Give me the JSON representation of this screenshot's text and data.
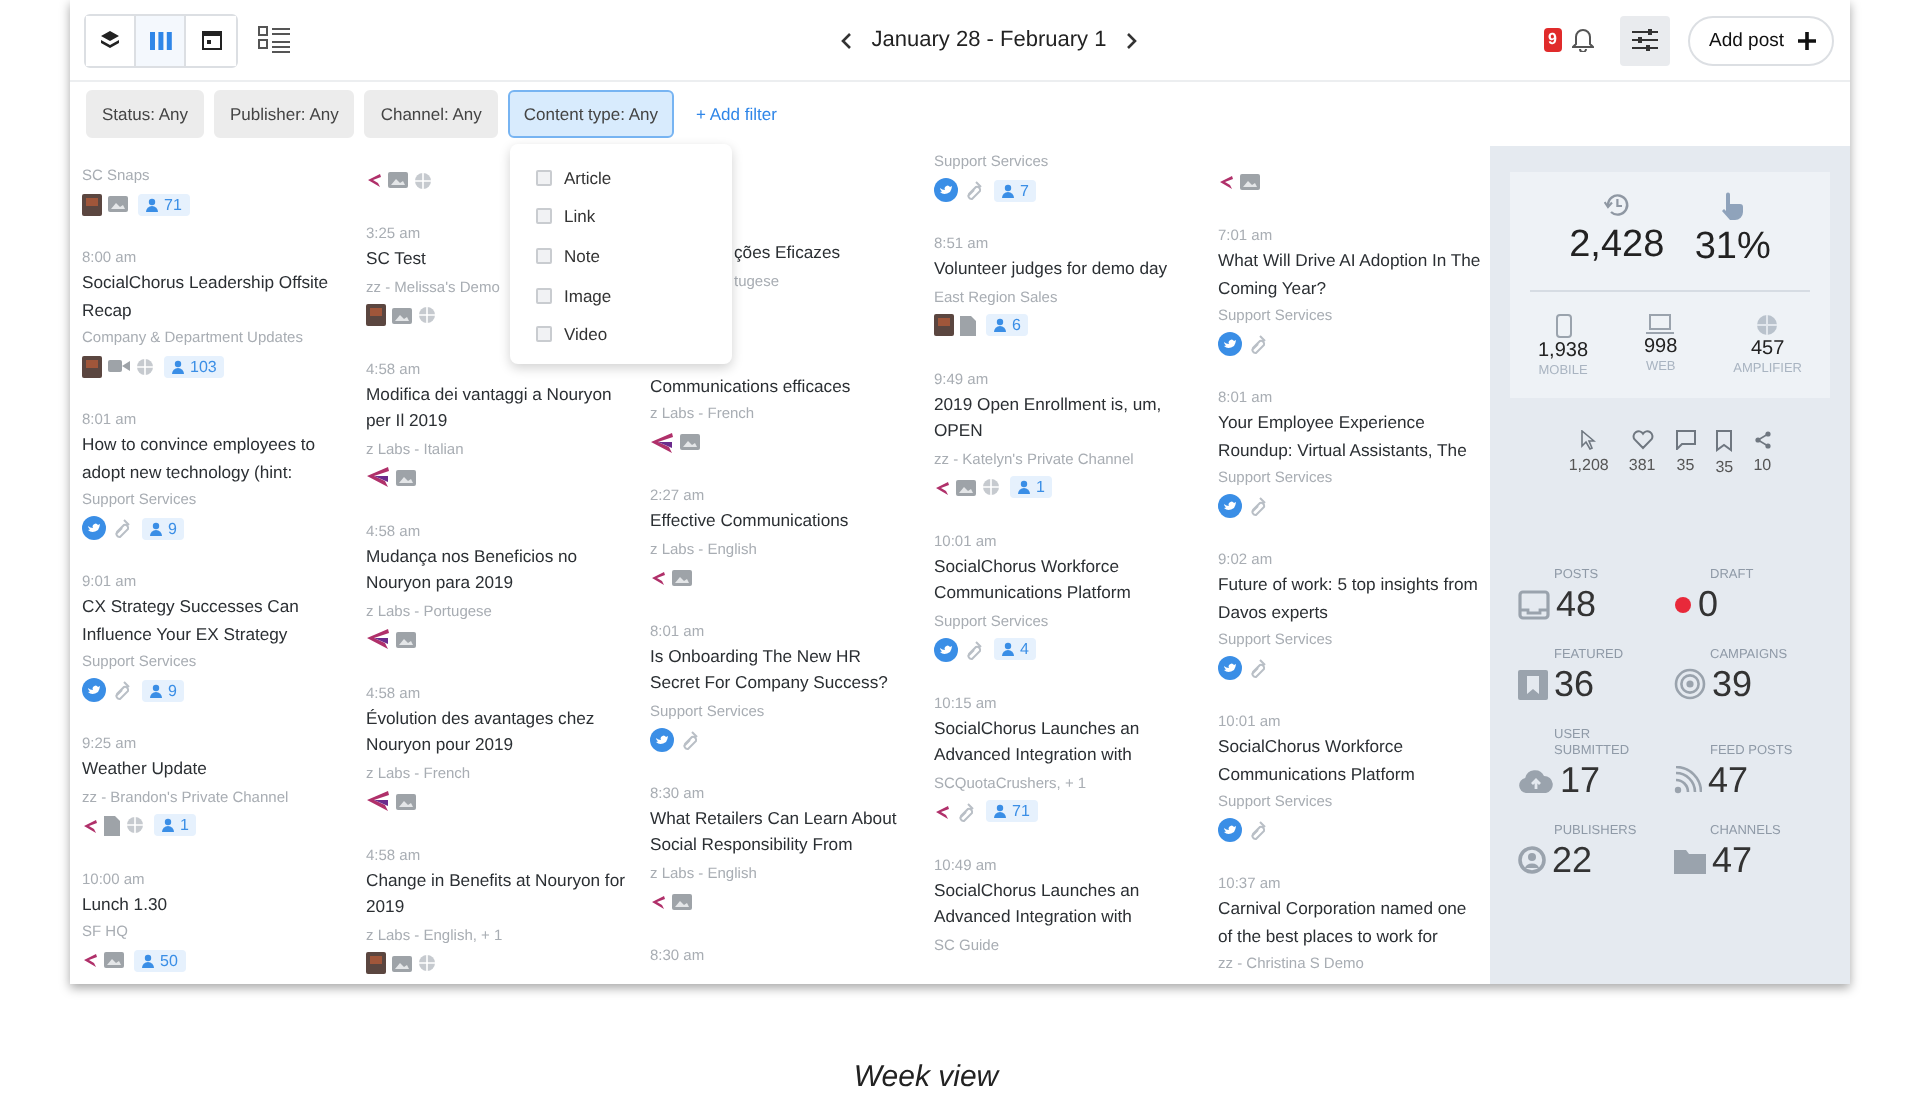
{
  "toolbar": {
    "view_buttons": [
      {
        "kind": "stack",
        "selected": false
      },
      {
        "kind": "columns",
        "selected": true
      },
      {
        "kind": "calendar",
        "selected": false
      }
    ],
    "date_range": "January 28 - February 1",
    "notifications": "9",
    "add_post": "Add post"
  },
  "filters": [
    {
      "label": "Status: Any",
      "selected": false
    },
    {
      "label": "Publisher: Any",
      "selected": false
    },
    {
      "label": "Channel: Any",
      "selected": false
    },
    {
      "label": "Content type: Any",
      "selected": true
    }
  ],
  "add_filter": "+ Add filter",
  "dropdown": {
    "options": [
      {
        "label": "Article",
        "checked": false
      },
      {
        "label": "Link",
        "checked": false
      },
      {
        "label": "Note",
        "checked": false
      },
      {
        "label": "Image",
        "checked": false
      },
      {
        "label": "Video",
        "checked": false
      }
    ]
  },
  "columns": [
    {
      "posts": [
        {
          "source": "SC Snaps",
          "icons": [
            {
              "kind": "thumb"
            },
            {
              "kind": "image"
            }
          ],
          "audience": "71"
        },
        {
          "time": "8:00 am",
          "title": "SocialChorus Leadership Offsite Recap",
          "source": "Company & Department Updates",
          "icons": [
            {
              "kind": "thumb"
            },
            {
              "kind": "video"
            },
            {
              "kind": "globe"
            }
          ],
          "audience": "103"
        },
        {
          "time": "8:01 am",
          "title": "How to convince employees to adopt new technology (hint:",
          "source": "Support Services",
          "icons": [
            {
              "kind": "bird"
            },
            {
              "kind": "link"
            }
          ],
          "audience": "9"
        },
        {
          "time": "9:01 am",
          "title": "CX Strategy Successes Can Influence Your EX Strategy",
          "source": "Support Services",
          "icons": [
            {
              "kind": "bird"
            },
            {
              "kind": "link"
            }
          ],
          "audience": "9"
        },
        {
          "time": "9:25 am",
          "title": "Weather Update",
          "source": "zz - Brandon's Private Channel",
          "icons": [
            {
              "kind": "swoosh"
            },
            {
              "kind": "doc"
            },
            {
              "kind": "globe"
            }
          ],
          "audience": "1"
        },
        {
          "time": "10:00 am",
          "title": "Lunch 1.30",
          "source": "SF HQ",
          "icons": [
            {
              "kind": "swoosh"
            },
            {
              "kind": "image"
            }
          ],
          "audience": "50"
        }
      ]
    },
    {
      "posts": [
        {
          "icons": [
            {
              "kind": "swoosh"
            },
            {
              "kind": "image"
            },
            {
              "kind": "globe"
            }
          ]
        },
        {
          "time": "3:25 am",
          "title": "SC Test",
          "source": "zz - Melissa's Demo",
          "icons": [
            {
              "kind": "thumb"
            },
            {
              "kind": "image"
            },
            {
              "kind": "globe"
            }
          ]
        },
        {
          "time": "4:58 am",
          "title": "Modifica dei vantaggi a Nouryon per Il 2019",
          "source": "z Labs - Italian",
          "icons": [
            {
              "kind": "swoosh-large"
            },
            {
              "kind": "image"
            }
          ]
        },
        {
          "time": "4:58 am",
          "title": "Mudança nos Beneficios no Nouryon para 2019",
          "source": "z Labs - Portugese",
          "icons": [
            {
              "kind": "swoosh-large"
            },
            {
              "kind": "image"
            }
          ]
        },
        {
          "time": "4:58 am",
          "title": "Évolution des avantages chez Nouryon pour 2019",
          "source": "z Labs - French",
          "icons": [
            {
              "kind": "swoosh-large"
            },
            {
              "kind": "image"
            }
          ]
        },
        {
          "time": "4:58 am",
          "title": "Change in Benefits at Nouryon for 2019",
          "source": "z Labs - English, + 1",
          "icons": [
            {
              "kind": "thumb"
            },
            {
              "kind": "image"
            },
            {
              "kind": "globe"
            }
          ]
        }
      ]
    },
    {
      "posts": [
        {
          "kind": "covered",
          "title": "ções Eficazes",
          "source": "tugese"
        },
        {
          "title": "Communications efficaces",
          "source": "z Labs - French",
          "icons": [
            {
              "kind": "swoosh-large"
            },
            {
              "kind": "image"
            }
          ]
        },
        {
          "time": "2:27 am",
          "title": "Effective Communications",
          "source": "z Labs - English",
          "icons": [
            {
              "kind": "swoosh"
            },
            {
              "kind": "image"
            }
          ]
        },
        {
          "time": "8:01 am",
          "title": "Is Onboarding The New HR Secret For Company Success?",
          "source": "Support Services",
          "icons": [
            {
              "kind": "bird"
            },
            {
              "kind": "link"
            }
          ]
        },
        {
          "time": "8:30 am",
          "title": "What Retailers Can Learn About Social Responsibility From",
          "source": "z Labs - English",
          "icons": [
            {
              "kind": "swoosh"
            },
            {
              "kind": "image"
            }
          ]
        },
        {
          "time": "8:30 am"
        }
      ]
    },
    {
      "posts": [
        {
          "source": "Support Services",
          "icons": [
            {
              "kind": "bird"
            },
            {
              "kind": "link"
            }
          ],
          "audience": "7"
        },
        {
          "time": "8:51 am",
          "title": "Volunteer judges for demo day",
          "source": "East Region Sales",
          "icons": [
            {
              "kind": "thumb"
            },
            {
              "kind": "doc"
            }
          ],
          "audience": "6"
        },
        {
          "time": "9:49 am",
          "title": "2019 Open Enrollment is, um, OPEN",
          "source": "zz - Katelyn's Private Channel",
          "icons": [
            {
              "kind": "swoosh"
            },
            {
              "kind": "image"
            },
            {
              "kind": "globe"
            }
          ],
          "audience": "1"
        },
        {
          "time": "10:01 am",
          "title": "SocialChorus Workforce Communications Platform",
          "source": "Support Services",
          "icons": [
            {
              "kind": "bird"
            },
            {
              "kind": "link"
            }
          ],
          "audience": "4"
        },
        {
          "time": "10:15 am",
          "title": "SocialChorus Launches an Advanced Integration with",
          "source": "SCQuotaCrushers, + 1",
          "icons": [
            {
              "kind": "swoosh"
            },
            {
              "kind": "link"
            }
          ],
          "audience": "71"
        },
        {
          "time": "10:49 am",
          "title": "SocialChorus Launches an Advanced Integration with",
          "source": "SC Guide"
        }
      ]
    },
    {
      "posts": [
        {
          "icons": [
            {
              "kind": "swoosh"
            },
            {
              "kind": "image"
            }
          ]
        },
        {
          "time": "7:01 am",
          "title": "What Will Drive AI Adoption In The Coming Year?",
          "source": "Support Services",
          "icons": [
            {
              "kind": "bird"
            },
            {
              "kind": "link"
            }
          ]
        },
        {
          "time": "8:01 am",
          "title": "Your Employee Experience Roundup: Virtual Assistants, The",
          "source": "Support Services",
          "icons": [
            {
              "kind": "bird"
            },
            {
              "kind": "link"
            }
          ]
        },
        {
          "time": "9:02 am",
          "title": "Future of work: 5 top insights from Davos experts",
          "source": "Support Services",
          "icons": [
            {
              "kind": "bird"
            },
            {
              "kind": "link"
            }
          ]
        },
        {
          "time": "10:01 am",
          "title": "SocialChorus Workforce Communications Platform",
          "source": "Support Services",
          "icons": [
            {
              "kind": "bird"
            },
            {
              "kind": "link"
            }
          ]
        },
        {
          "time": "10:37 am",
          "title": "Carnival Corporation named one of the best places to work for",
          "source": "zz - Christina S Demo"
        }
      ]
    }
  ],
  "stats": {
    "reach": "2,428",
    "engagement": "31%",
    "breakdown": [
      {
        "kind": "mobile",
        "value": "1,938",
        "label": "MOBILE"
      },
      {
        "kind": "web",
        "value": "998",
        "label": "WEB"
      },
      {
        "kind": "amplifier",
        "value": "457",
        "label": "AMPLIFIER"
      }
    ],
    "actions": [
      {
        "kind": "clicks",
        "value": "1,208"
      },
      {
        "kind": "likes",
        "value": "381"
      },
      {
        "kind": "comments",
        "value": "35"
      },
      {
        "kind": "bookmarks",
        "value": "35"
      },
      {
        "kind": "shares",
        "value": "10"
      }
    ],
    "tiles": [
      {
        "kind": "posts",
        "label": "POSTS",
        "value": "48"
      },
      {
        "kind": "draft",
        "label": "DRAFT",
        "value": "0"
      },
      {
        "kind": "featured",
        "label": "FEATURED",
        "value": "36"
      },
      {
        "kind": "campaigns",
        "label": "CAMPAIGNS",
        "value": "39"
      },
      {
        "kind": "submitted",
        "label": "USER SUBMITTED",
        "value": "17"
      },
      {
        "kind": "feeds",
        "label": "FEED POSTS",
        "value": "47"
      },
      {
        "kind": "publishers",
        "label": "PUBLISHERS",
        "value": "22"
      },
      {
        "kind": "channels",
        "label": "CHANNELS",
        "value": "47"
      }
    ]
  },
  "caption": "Week view"
}
